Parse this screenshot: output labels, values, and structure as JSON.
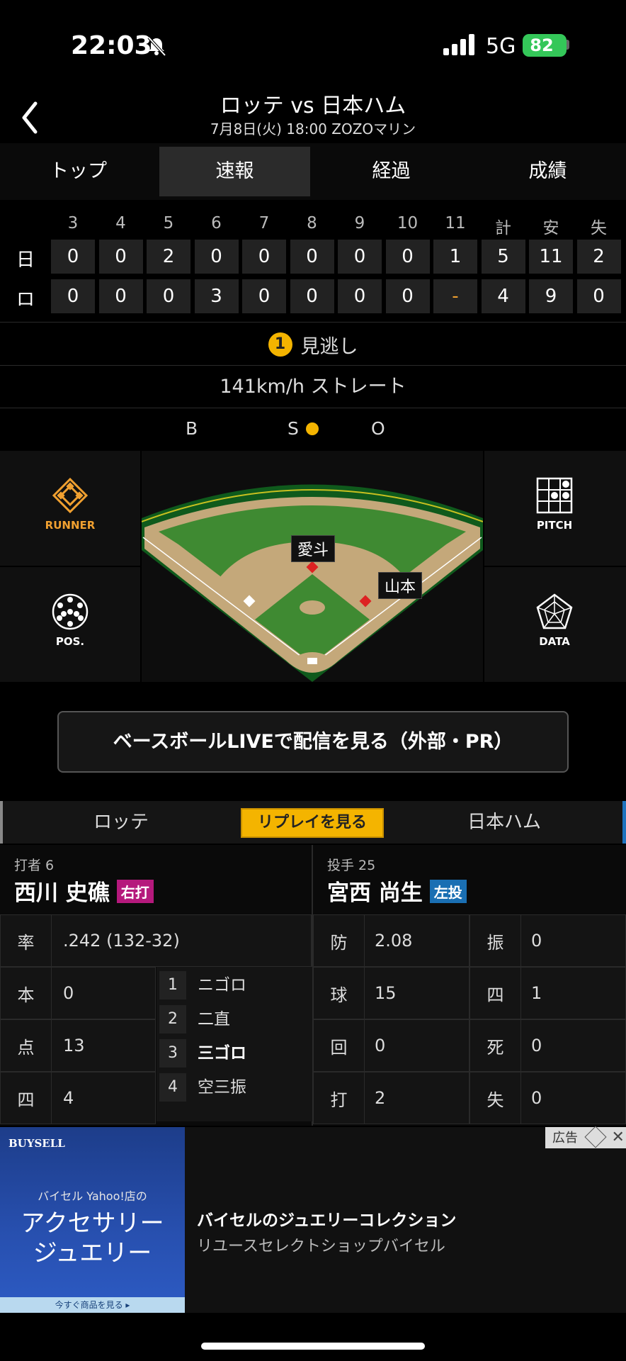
{
  "status": {
    "time": "22:03",
    "network": "5G",
    "battery": "82"
  },
  "header": {
    "title": "ロッテ vs 日本ハム",
    "subtitle": "7月8日(火) 18:00 ZOZOマリン"
  },
  "tabs": [
    "トップ",
    "速報",
    "経過",
    "成績"
  ],
  "active_tab": 1,
  "scoreboard": {
    "headers": [
      "3",
      "4",
      "5",
      "6",
      "7",
      "8",
      "9",
      "10",
      "11",
      "計",
      "安",
      "失"
    ],
    "rows": [
      {
        "team": "日",
        "values": [
          "0",
          "0",
          "2",
          "0",
          "0",
          "0",
          "0",
          "0",
          "1",
          "5",
          "11",
          "2"
        ]
      },
      {
        "team": "ロ",
        "values": [
          "0",
          "0",
          "0",
          "3",
          "0",
          "0",
          "0",
          "0",
          "-",
          "4",
          "9",
          "0"
        ]
      }
    ]
  },
  "pitch_result": {
    "number": "1",
    "label": "見逃し"
  },
  "pitch_info": "141km/h ストレート",
  "count": {
    "b_label": "B",
    "s_label": "S",
    "o_label": "O",
    "balls": 0,
    "strikes": 1,
    "outs": 0
  },
  "side_buttons": {
    "runner": "RUNNER",
    "pos": "POS.",
    "pitch": "PITCH",
    "data": "DATA"
  },
  "field_players": {
    "pitcher": "愛斗",
    "batter": "山本"
  },
  "live_button": "ベースボールLIVEで配信を見る（外部・PR）",
  "teambar": {
    "home": "ロッテ",
    "replay": "リプレイを見る",
    "away": "日本ハム"
  },
  "batter": {
    "role": "打者 6",
    "name": "西川 史礁",
    "hand": "右打",
    "avg_label": "率",
    "avg": ".242 (132-32)",
    "stats": [
      {
        "k": "本",
        "v": "0"
      },
      {
        "k": "点",
        "v": "13"
      },
      {
        "k": "四",
        "v": "4"
      }
    ],
    "at_bats": [
      {
        "n": "1",
        "t": "ニゴロ"
      },
      {
        "n": "2",
        "t": "二直"
      },
      {
        "n": "3",
        "t": "三ゴロ"
      },
      {
        "n": "4",
        "t": "空三振"
      }
    ]
  },
  "pitcher": {
    "role": "投手 25",
    "name": "宮西 尚生",
    "hand": "左投",
    "stats": [
      {
        "k": "防",
        "v": "2.08",
        "k2": "振",
        "v2": "0"
      },
      {
        "k": "球",
        "v": "15",
        "k2": "四",
        "v2": "1"
      },
      {
        "k": "回",
        "v": "0",
        "k2": "死",
        "v2": "0"
      },
      {
        "k": "打",
        "v": "2",
        "k2": "失",
        "v2": "0"
      }
    ]
  },
  "ad": {
    "brand": "BUYSELL",
    "img_sub": "バイセル Yahoo!店の",
    "img_big1": "アクセサリー",
    "img_big2": "ジュエリー",
    "img_cta": "今すぐ商品を見る ▸",
    "title": "バイセルのジュエリーコレクション",
    "desc": "リユースセレクトショップバイセル",
    "badge": "広告"
  }
}
